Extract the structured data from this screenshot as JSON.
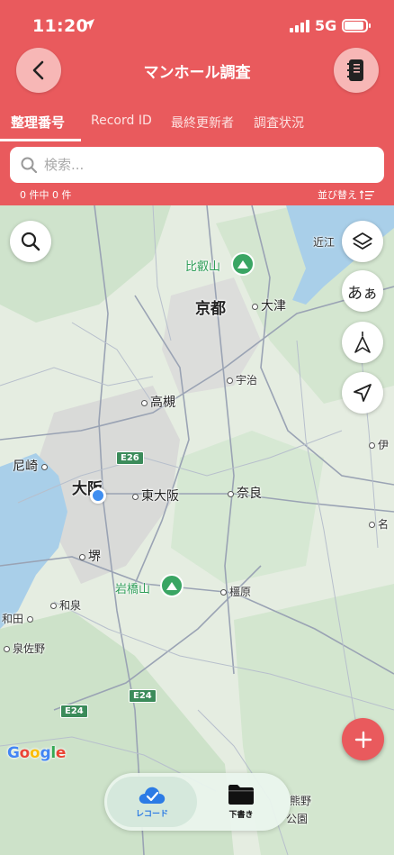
{
  "status_bar": {
    "time": "11:20",
    "network": "5G"
  },
  "header": {
    "title": "マンホール調査"
  },
  "tabs": [
    {
      "label": "整理番号"
    },
    {
      "label": "Record ID"
    },
    {
      "label": "最終更新者"
    },
    {
      "label": "調査状況"
    }
  ],
  "search": {
    "placeholder": "検索..."
  },
  "list_info": {
    "count": "0 件中 0 件",
    "sort_label": "並び替え"
  },
  "map": {
    "labels": {
      "hieizan": "比叡山",
      "kyoto": "京都",
      "otsu": "大津",
      "uji": "宇治",
      "takatsuki": "高槻",
      "amagasaki": "尼崎",
      "osaka": "大阪",
      "higashiosaka": "東大阪",
      "nara": "奈良",
      "sakai": "堺",
      "iwahashiyama": "岩橋山",
      "izumi": "和泉",
      "kashihara": "橿原",
      "wada": "和田",
      "izumisano": "泉佐野",
      "omi": "近江",
      "kumano": "熊野",
      "koen": "公園",
      "tabi": "あぁ",
      "na": "名",
      "i": "伊"
    },
    "shields": {
      "e26": "E26",
      "e24a": "E24",
      "e24b": "E24"
    },
    "attribution": "Google"
  },
  "bottom_nav": {
    "records_label": "レコード",
    "drafts_label": "下書き"
  },
  "colors": {
    "accent": "#e95a5d",
    "water": "#a9cfe9",
    "land": "#e8efe4"
  }
}
